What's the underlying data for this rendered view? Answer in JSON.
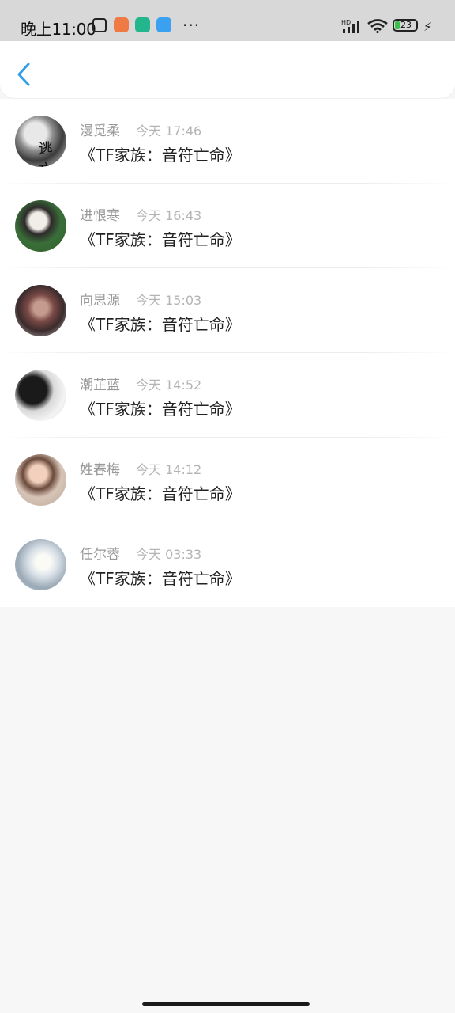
{
  "status_bar": {
    "time": "晚上11:00",
    "network_label": "HD",
    "battery_level": "23",
    "more_dots": "···",
    "icons": [
      "nfc-icon",
      "app-icon-orange",
      "app-icon-green",
      "app-icon-blue",
      "signal-icon",
      "wifi-icon",
      "battery-icon",
      "charging-icon"
    ]
  },
  "header": {
    "back_icon": "chevron-left-icon",
    "accent_color": "#2f9fe6"
  },
  "items": [
    {
      "name": "漫觅柔",
      "time": "今天 17:46",
      "title": "《TF家族：音符亡命》",
      "avatar_text": "逃亡"
    },
    {
      "name": "进恨寒",
      "time": "今天 16:43",
      "title": "《TF家族：音符亡命》"
    },
    {
      "name": "向思源",
      "time": "今天 15:03",
      "title": "《TF家族：音符亡命》"
    },
    {
      "name": "潮芷蓝",
      "time": "今天 14:52",
      "title": "《TF家族：音符亡命》"
    },
    {
      "name": "姓春梅",
      "time": "今天 14:12",
      "title": "《TF家族：音符亡命》"
    },
    {
      "name": "任尔蓉",
      "time": "今天 03:33",
      "title": "《TF家族：音符亡命》"
    }
  ]
}
